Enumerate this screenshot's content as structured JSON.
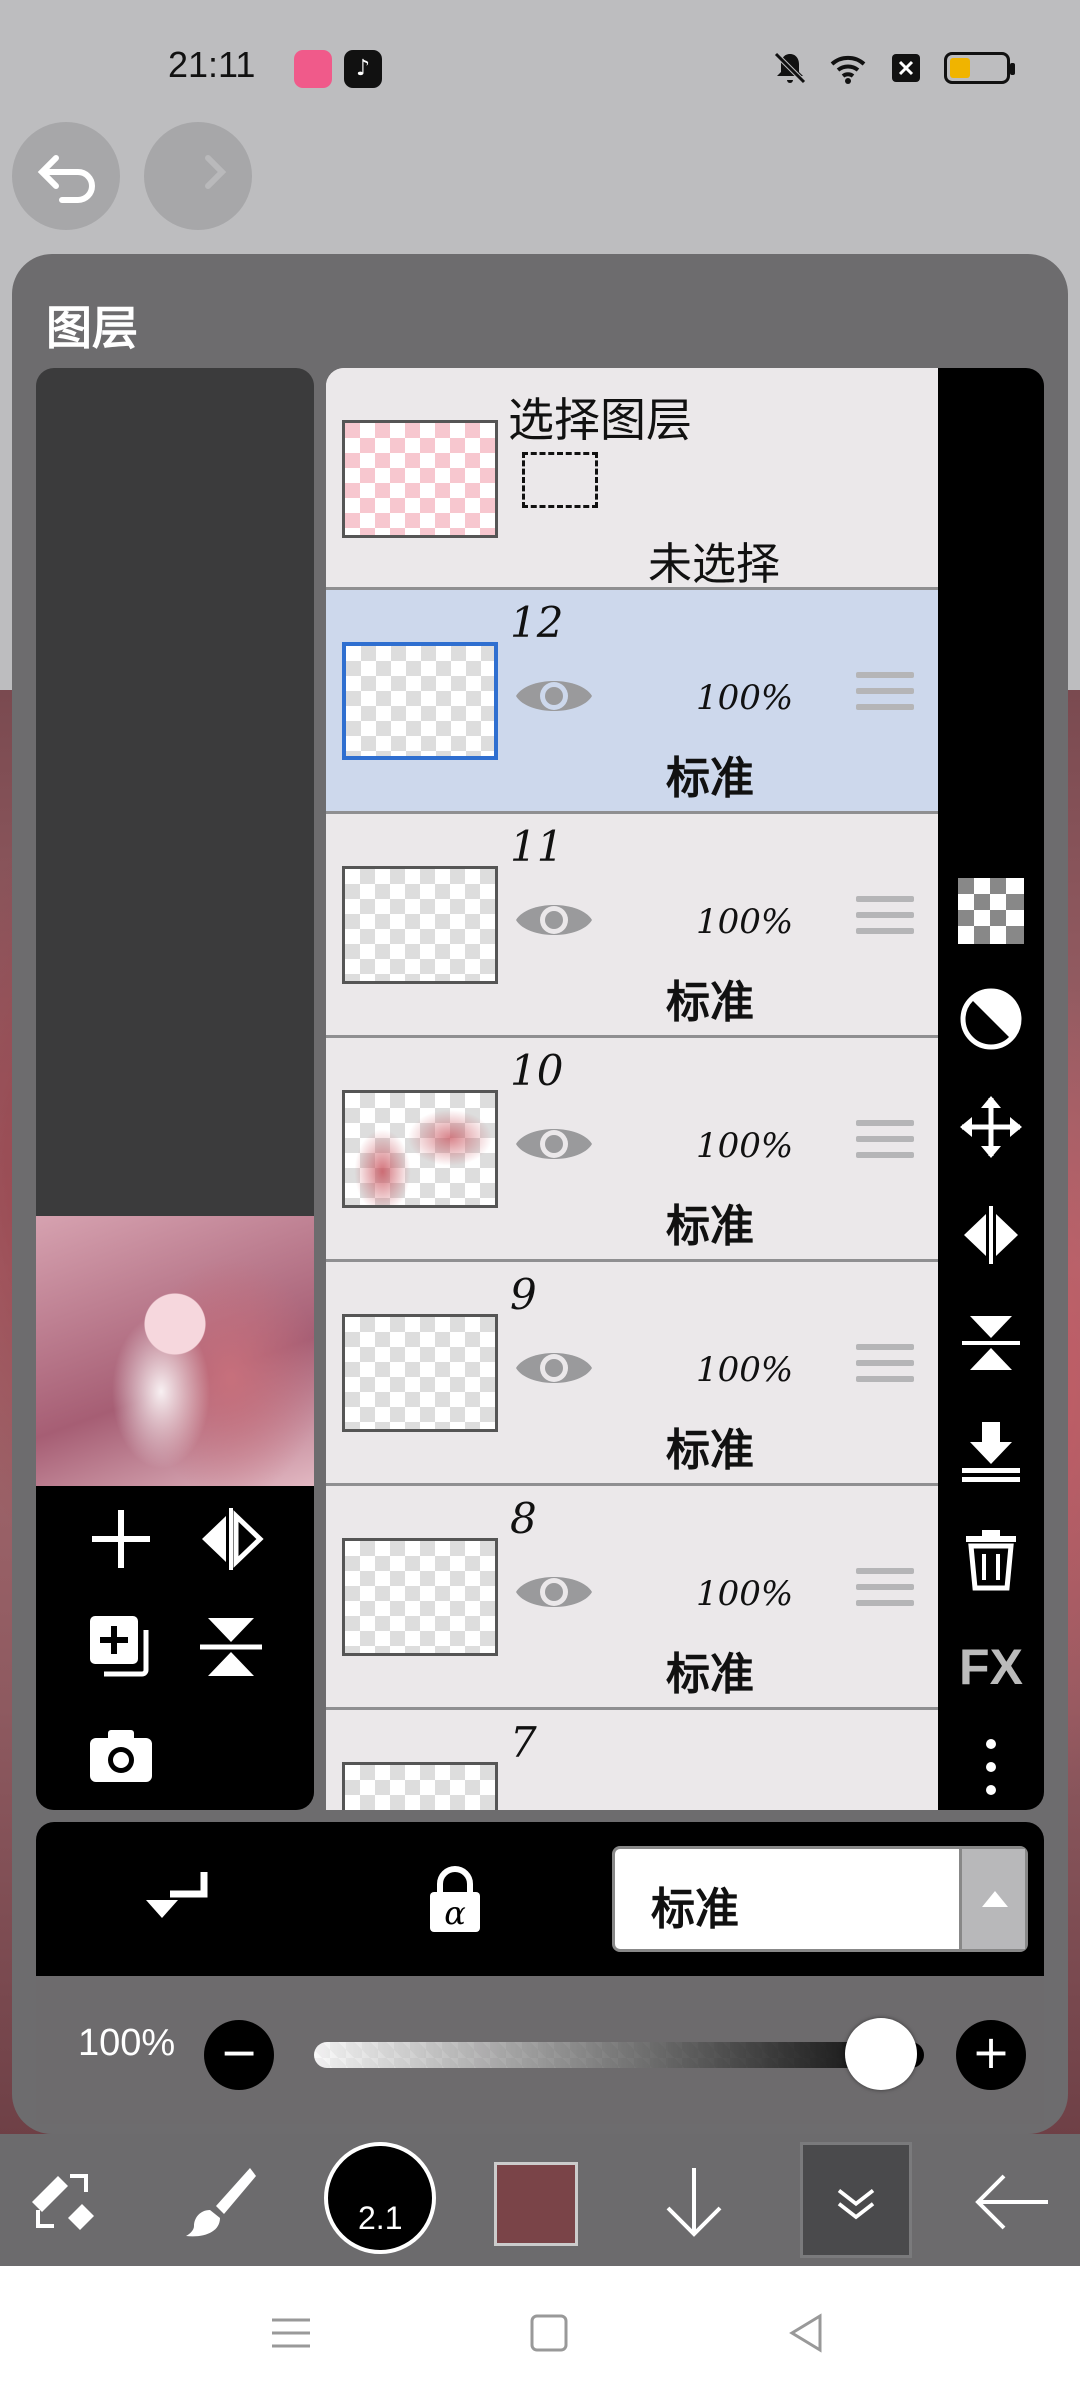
{
  "status_bar": {
    "time": "21:11",
    "icons": [
      "bilibili-icon",
      "tiktok-icon",
      "mute-icon",
      "wifi-icon",
      "sim-off-icon",
      "battery-icon"
    ]
  },
  "panel": {
    "title": "图层"
  },
  "selection_row": {
    "title": "选择图层",
    "status": "未选择"
  },
  "layers": [
    {
      "number": "12",
      "opacity": "100%",
      "blend": "标准",
      "selected": true
    },
    {
      "number": "11",
      "opacity": "100%",
      "blend": "标准",
      "selected": false
    },
    {
      "number": "10",
      "opacity": "100%",
      "blend": "标准",
      "selected": false
    },
    {
      "number": "9",
      "opacity": "100%",
      "blend": "标准",
      "selected": false
    },
    {
      "number": "8",
      "opacity": "100%",
      "blend": "标准",
      "selected": false
    },
    {
      "number": "7",
      "opacity": "",
      "blend": "",
      "selected": false
    }
  ],
  "right_tools": {
    "fx_label": "FX"
  },
  "blend_mode": {
    "current": "标准"
  },
  "opacity_control": {
    "label": "100%",
    "value_fraction": 1.0
  },
  "toolbar": {
    "brush_size": "2.1",
    "current_color": "#7a4448"
  },
  "colors": {
    "selected_row": "#cdd8ec",
    "selected_border": "#2f6fd0"
  }
}
